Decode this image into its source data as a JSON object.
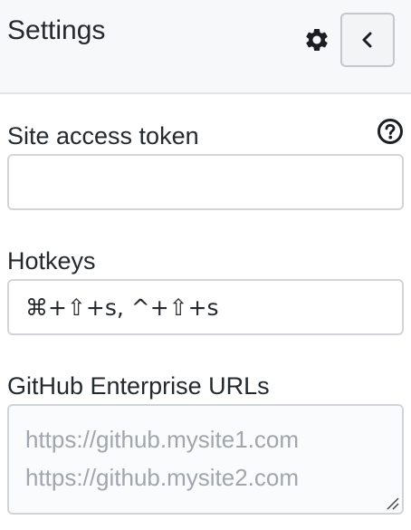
{
  "header": {
    "title": "Settings",
    "gear_icon": "gear-icon",
    "back_icon": "chevron-left-icon"
  },
  "fields": {
    "token": {
      "label": "Site access token",
      "value": "",
      "help_icon": "question-circle-icon"
    },
    "hotkeys": {
      "label": "Hotkeys",
      "value": "⌘+⇧+s, ^+⇧+s"
    },
    "enterprise": {
      "label": "GitHub Enterprise URLs",
      "value": "",
      "placeholder": "https://github.mysite1.com\nhttps://github.mysite2.com"
    }
  },
  "colors": {
    "header_bg": "#f6f8fa",
    "text": "#24292e",
    "border": "#d1d5da",
    "placeholder": "#a0a6ad"
  }
}
